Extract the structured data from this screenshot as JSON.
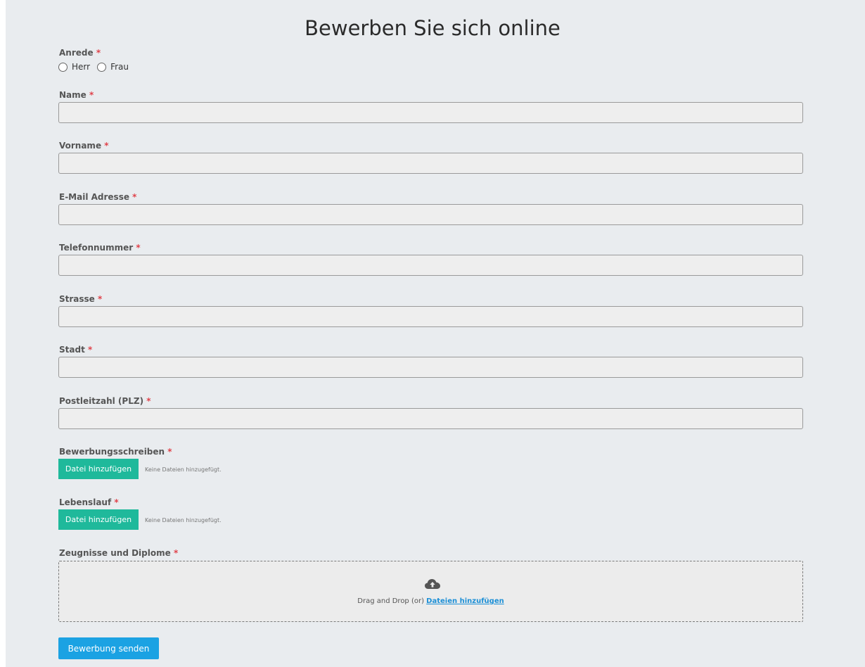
{
  "title": "Bewerben Sie sich online",
  "required_mark": "*",
  "anrede": {
    "label": "Anrede",
    "options": [
      "Herr",
      "Frau"
    ]
  },
  "fields": {
    "name": {
      "label": "Name",
      "value": ""
    },
    "vorname": {
      "label": "Vorname",
      "value": ""
    },
    "email": {
      "label": "E-Mail Adresse",
      "value": ""
    },
    "telefon": {
      "label": "Telefonnummer",
      "value": ""
    },
    "strasse": {
      "label": "Strasse",
      "value": ""
    },
    "stadt": {
      "label": "Stadt",
      "value": ""
    },
    "plz": {
      "label": "Postleitzahl (PLZ)",
      "value": ""
    }
  },
  "uploads": {
    "anschreiben": {
      "label": "Bewerbungsschreiben",
      "button": "Datei hinzufügen",
      "status": "Keine Dateien hinzugefügt."
    },
    "lebenslauf": {
      "label": "Lebenslauf",
      "button": "Datei hinzufügen",
      "status": "Keine Dateien hinzugefügt."
    }
  },
  "dropzone": {
    "label": "Zeugnisse und Diplome",
    "text": "Drag and Drop (or) ",
    "link": "Dateien hinzufügen",
    "icon": "cloud-upload-icon"
  },
  "submit_label": "Bewerbung senden",
  "colors": {
    "background": "#e9ecef",
    "accent_green": "#1fb99b",
    "accent_blue": "#1ba2e3",
    "required": "#e0434b",
    "link": "#1c8fd6"
  }
}
